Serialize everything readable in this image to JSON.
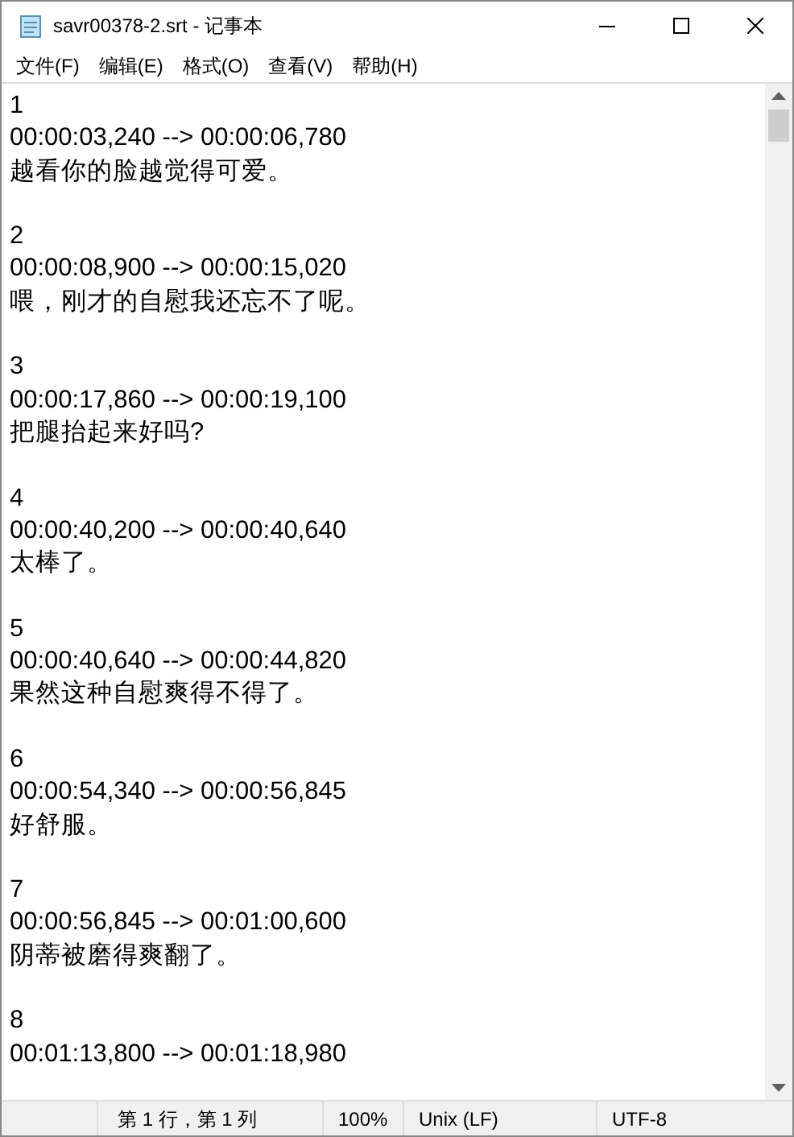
{
  "window": {
    "title": "savr00378-2.srt - 记事本"
  },
  "menu": [
    "文件(F)",
    "编辑(E)",
    "格式(O)",
    "查看(V)",
    "帮助(H)"
  ],
  "subtitles": [
    {
      "index": "1",
      "timing": "00:00:03,240 --> 00:00:06,780",
      "text": "越看你的脸越觉得可爱。"
    },
    {
      "index": "2",
      "timing": "00:00:08,900 --> 00:00:15,020",
      "text": "喂，刚才的自慰我还忘不了呢。"
    },
    {
      "index": "3",
      "timing": "00:00:17,860 --> 00:00:19,100",
      "text": "把腿抬起来好吗?"
    },
    {
      "index": "4",
      "timing": "00:00:40,200 --> 00:00:40,640",
      "text": "太棒了。"
    },
    {
      "index": "5",
      "timing": "00:00:40,640 --> 00:00:44,820",
      "text": "果然这种自慰爽得不得了。"
    },
    {
      "index": "6",
      "timing": "00:00:54,340 --> 00:00:56,845",
      "text": "好舒服。"
    },
    {
      "index": "7",
      "timing": "00:00:56,845 --> 00:01:00,600",
      "text": "阴蒂被磨得爽翻了。"
    },
    {
      "index": "8",
      "timing": "00:01:13,800 --> 00:01:18,980"
    }
  ],
  "status_bar": {
    "position": "第 1 行，第 1 列",
    "zoom": "100%",
    "line_ending": "Unix (LF)",
    "encoding": "UTF-8"
  }
}
